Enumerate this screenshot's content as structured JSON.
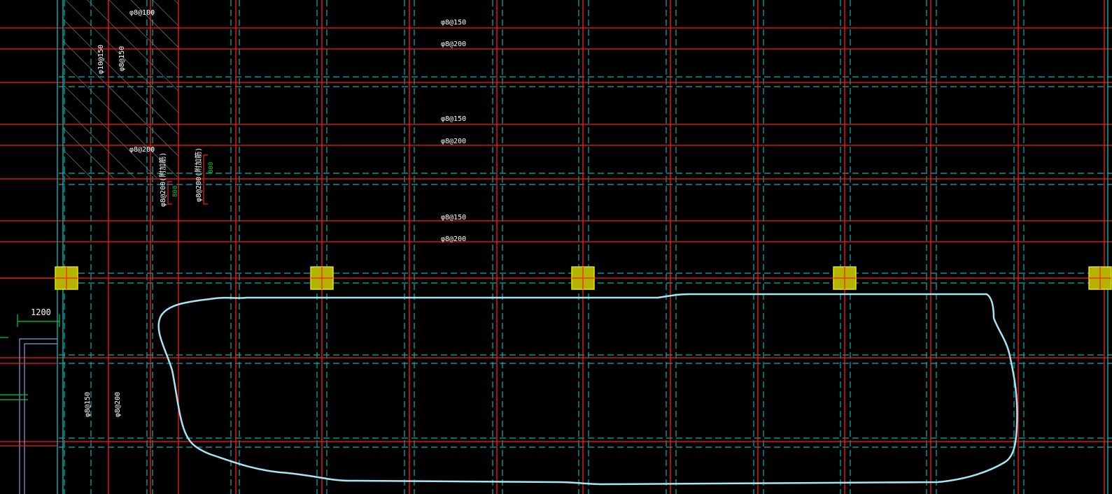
{
  "colors": {
    "background": "#000000",
    "rebar_red": "#ff1a1a",
    "grid_cyan": "#00b3b3",
    "column_fill": "#b3b300",
    "column_stroke": "#e6e600",
    "cloud_outline": "#a6e6f2",
    "dimension_green": "#00cc33",
    "text_white": "#ffffff",
    "hatch_gray": "#bfbfbf"
  },
  "labels": {
    "top_bar_1": "φ8@150",
    "top_bar_2": "φ8@200",
    "mid_bar_1": "φ8@150",
    "mid_bar_2": "φ8@200",
    "low_bar_1": "φ8@150",
    "low_bar_2": "φ8@200",
    "hatch_top": "φ8@100",
    "hatch_bottom": "φ8@200",
    "hatch_vert_1": "φ10@150",
    "hatch_vert_2": "φ8@150",
    "slab_support_1": "φ8@200(附加筋)",
    "slab_support_2": "φ8@200(附加筋)",
    "left_vert_1": "φ8@150",
    "left_vert_2": "φ8@200",
    "dim_800_a": "800",
    "dim_800_b": "800",
    "dim_1200": "1200"
  }
}
